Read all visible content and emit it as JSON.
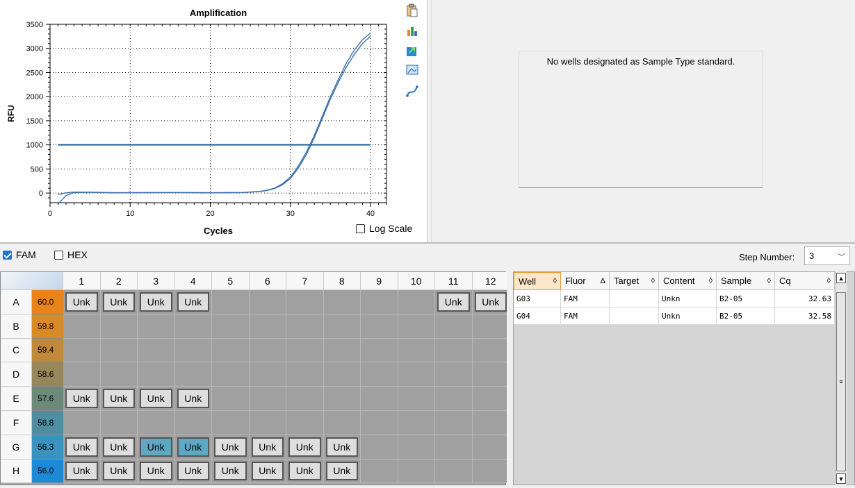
{
  "chart_data": {
    "type": "line",
    "title": "Amplification",
    "xlabel": "Cycles",
    "ylabel": "RFU",
    "xlim": [
      0,
      42
    ],
    "ylim": [
      -200,
      3500
    ],
    "x_ticks": [
      0,
      10,
      20,
      30,
      40
    ],
    "y_ticks": [
      0,
      500,
      1000,
      1500,
      2000,
      2500,
      3000,
      3500
    ],
    "grid": true,
    "threshold": 1000,
    "series": [
      {
        "x": [
          1,
          2,
          3,
          5,
          8,
          12,
          16,
          20,
          24,
          26,
          27,
          28,
          29,
          30,
          31,
          32,
          33,
          34,
          35,
          36,
          37,
          38,
          39,
          40
        ],
        "y": [
          -230,
          -50,
          10,
          15,
          5,
          8,
          12,
          5,
          10,
          30,
          50,
          90,
          170,
          300,
          520,
          800,
          1150,
          1550,
          1950,
          2300,
          2620,
          2880,
          3100,
          3250
        ]
      },
      {
        "x": [
          1,
          2,
          3,
          5,
          8,
          12,
          16,
          20,
          24,
          26,
          27,
          28,
          29,
          30,
          31,
          32,
          33,
          34,
          35,
          36,
          37,
          38,
          39,
          40
        ],
        "y": [
          -30,
          5,
          20,
          18,
          8,
          10,
          10,
          7,
          12,
          32,
          55,
          100,
          190,
          330,
          560,
          850,
          1200,
          1600,
          2000,
          2360,
          2700,
          2970,
          3180,
          3320
        ]
      }
    ],
    "colors": {
      "line": "#3b6fa8",
      "threshold": "#1f5f95"
    }
  },
  "log_scale": {
    "label": "Log Scale",
    "checked": false
  },
  "toolbar_icons": [
    "clipboard-icon",
    "chart-settings-icon",
    "export-icon",
    "image-icon",
    "curve-icon"
  ],
  "standard_curve": {
    "message": "No wells designated as Sample Type standard."
  },
  "fluors": [
    {
      "label": "FAM",
      "checked": true
    },
    {
      "label": "HEX",
      "checked": false
    }
  ],
  "step": {
    "label": "Step Number:",
    "value": "3"
  },
  "plate": {
    "columns": [
      "1",
      "2",
      "3",
      "4",
      "5",
      "6",
      "7",
      "8",
      "9",
      "10",
      "11",
      "12"
    ],
    "rows": [
      {
        "label": "A",
        "temp": "60.0",
        "temp_color": "#e8841a",
        "wells": [
          "Unk",
          "Unk",
          "Unk",
          "Unk",
          "",
          "",
          "",
          "",
          "",
          "",
          "Unk",
          "Unk"
        ],
        "selected": []
      },
      {
        "label": "B",
        "temp": "59.8",
        "temp_color": "#d88a24",
        "wells": [
          "",
          "",
          "",
          "",
          "",
          "",
          "",
          "",
          "",
          "",
          "",
          ""
        ],
        "selected": []
      },
      {
        "label": "C",
        "temp": "59.4",
        "temp_color": "#c08a3a",
        "wells": [
          "",
          "",
          "",
          "",
          "",
          "",
          "",
          "",
          "",
          "",
          "",
          ""
        ],
        "selected": []
      },
      {
        "label": "D",
        "temp": "58.6",
        "temp_color": "#97875a",
        "wells": [
          "",
          "",
          "",
          "",
          "",
          "",
          "",
          "",
          "",
          "",
          "",
          ""
        ],
        "selected": []
      },
      {
        "label": "E",
        "temp": "57.6",
        "temp_color": "#6b8a7c",
        "wells": [
          "Unk",
          "Unk",
          "Unk",
          "Unk",
          "",
          "",
          "",
          "",
          "",
          "",
          "",
          ""
        ],
        "selected": []
      },
      {
        "label": "F",
        "temp": "56.8",
        "temp_color": "#4f8ea0",
        "wells": [
          "",
          "",
          "",
          "",
          "",
          "",
          "",
          "",
          "",
          "",
          "",
          ""
        ],
        "selected": []
      },
      {
        "label": "G",
        "temp": "56.3",
        "temp_color": "#3893bf",
        "wells": [
          "Unk",
          "Unk",
          "Unk",
          "Unk",
          "Unk",
          "Unk",
          "Unk",
          "Unk",
          "",
          "",
          "",
          ""
        ],
        "selected": [
          2,
          3
        ]
      },
      {
        "label": "H",
        "temp": "56.0",
        "temp_color": "#1d8ad8",
        "wells": [
          "Unk",
          "Unk",
          "Unk",
          "Unk",
          "Unk",
          "Unk",
          "Unk",
          "Unk",
          "",
          "",
          "",
          ""
        ],
        "selected": []
      }
    ]
  },
  "results": {
    "headers": [
      "Well",
      "Fluor",
      "Target",
      "Content",
      "Sample",
      "Cq"
    ],
    "sort_glyphs": [
      "◊",
      "Δ",
      "◊",
      "◊",
      "◊",
      "◊"
    ],
    "rows": [
      [
        "G03",
        "FAM",
        "",
        "Unkn",
        "B2-05",
        "32.63"
      ],
      [
        "G04",
        "FAM",
        "",
        "Unkn",
        "B2-05",
        "32.58"
      ]
    ]
  }
}
